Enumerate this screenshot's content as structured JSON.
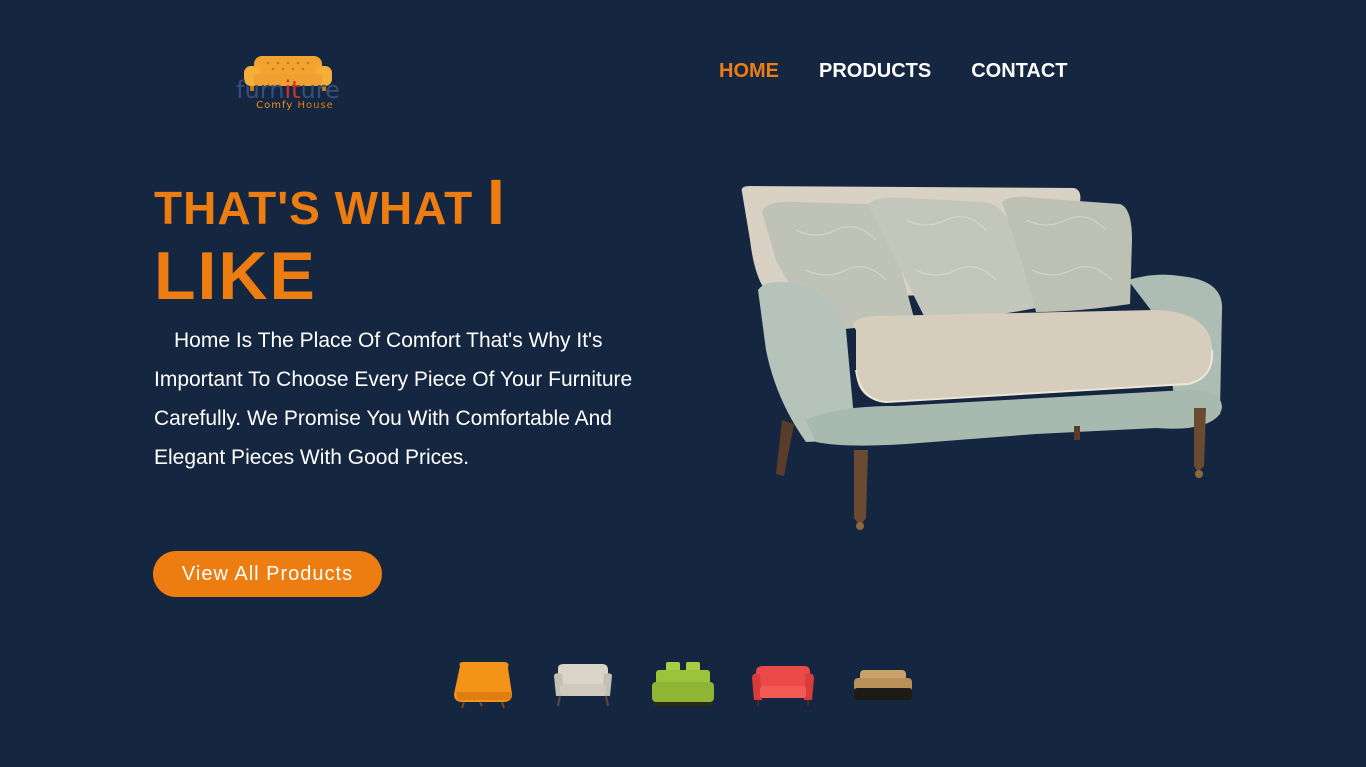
{
  "logo": {
    "word_a": "furn",
    "word_hl": "it",
    "word_b": "ure",
    "tagline_a": "Comfy ",
    "tagline_b": "House",
    "icon": "sofa-logo-icon"
  },
  "nav": {
    "items": [
      {
        "label": "HOME",
        "active": true
      },
      {
        "label": "PRODUCTS",
        "active": false
      },
      {
        "label": "CONTACT",
        "active": false
      }
    ]
  },
  "hero": {
    "title_line1": "THAT'S WHAT ",
    "title_line1_big": "I",
    "title_line2": "LIKE",
    "description": "Home Is The Place Of Comfort That's Why It's Important To Choose Every Piece Of Your Furniture Carefully. We Promise You With Comfortable And Elegant Pieces With Good Prices.",
    "cta_label": "View All Products",
    "image": "grey-loveseat-sofa-image"
  },
  "thumbnails": [
    {
      "name": "orange-sofa-thumbnail",
      "color": "#f39419"
    },
    {
      "name": "grey-sofa-thumbnail",
      "color": "#c9c6bd"
    },
    {
      "name": "green-sofa-thumbnail",
      "color": "#9cc43a"
    },
    {
      "name": "red-sofa-thumbnail",
      "color": "#ec4a48"
    },
    {
      "name": "tan-sofa-thumbnail",
      "color": "#c9a36a"
    }
  ],
  "colors": {
    "background": "#152641",
    "accent": "#ee7d11",
    "text": "#ffffff"
  }
}
